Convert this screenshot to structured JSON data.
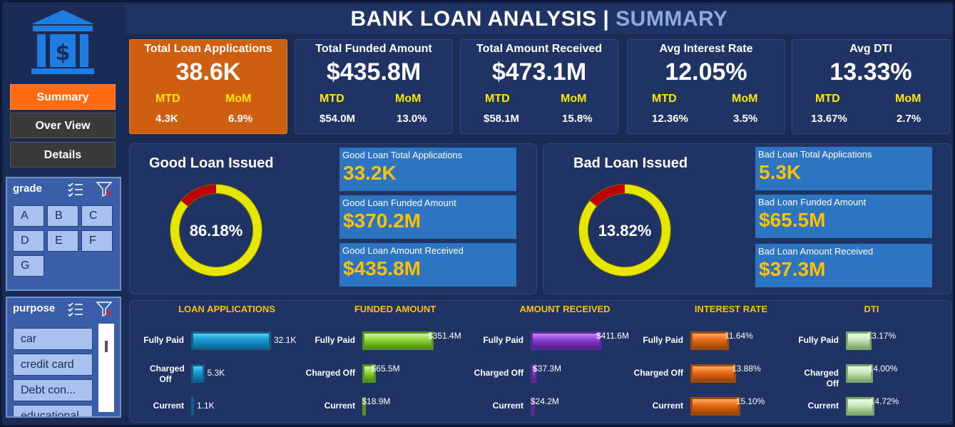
{
  "header": {
    "title_main": "BANK LOAN ANALYSIS",
    "separator": "|",
    "title_sub": "SUMMARY"
  },
  "nav": {
    "summary": "Summary",
    "overview": "Over View",
    "details": "Details"
  },
  "slicers": {
    "grade": {
      "label": "grade",
      "items": [
        "A",
        "B",
        "C",
        "D",
        "E",
        "F",
        "G"
      ]
    },
    "purpose": {
      "label": "purpose",
      "items": [
        "car",
        "credit card",
        "Debt con...",
        "educational"
      ]
    }
  },
  "kpis": [
    {
      "title": "Total Loan Applications",
      "value": "38.6K",
      "mtd_label": "MTD",
      "mom_label": "MoM",
      "mtd": "4.3K",
      "mom": "6.9%"
    },
    {
      "title": "Total Funded Amount",
      "value": "$435.8M",
      "mtd_label": "MTD",
      "mom_label": "MoM",
      "mtd": "$54.0M",
      "mom": "13.0%"
    },
    {
      "title": "Total Amount Received",
      "value": "$473.1M",
      "mtd_label": "MTD",
      "mom_label": "MoM",
      "mtd": "$58.1M",
      "mom": "15.8%"
    },
    {
      "title": "Avg Interest Rate",
      "value": "12.05%",
      "mtd_label": "MTD",
      "mom_label": "MoM",
      "mtd": "12.36%",
      "mom": "3.5%"
    },
    {
      "title": "Avg DTI",
      "value": "13.33%",
      "mtd_label": "MTD",
      "mom_label": "MoM",
      "mtd": "13.67%",
      "mom": "2.7%"
    }
  ],
  "good_loan": {
    "title": "Good Loan Issued",
    "percent_label": "86.18%",
    "percent": 0.8618,
    "tiles": [
      {
        "label": "Good Loan Total Applications",
        "value": "33.2K"
      },
      {
        "label": "Good Loan Funded Amount",
        "value": "$370.2M"
      },
      {
        "label": "Good Loan Amount Received",
        "value": "$435.8M"
      }
    ]
  },
  "bad_loan": {
    "title": "Bad Loan Issued",
    "percent_label": "13.82%",
    "percent": 0.1382,
    "tiles": [
      {
        "label": "Bad Loan Total Applications",
        "value": "5.3K"
      },
      {
        "label": "Bad Loan Funded Amount",
        "value": "$65.5M"
      },
      {
        "label": "Bad Loan Amount Received",
        "value": "$37.3M"
      }
    ]
  },
  "colors": {
    "accent_orange": "#ff6a13",
    "value_gold": "#ffc000",
    "mtd_yellow": "#ffe600"
  },
  "chart_data": [
    {
      "type": "bar",
      "title": "LOAN APPLICATIONS",
      "categories": [
        "Fully Paid",
        "Charged Off",
        "Current"
      ],
      "values": [
        32100,
        5300,
        1100
      ],
      "labels": [
        "32.1K",
        "5.3K",
        "1.1K"
      ]
    },
    {
      "type": "bar",
      "title": "FUNDED AMOUNT",
      "categories": [
        "Fully Paid",
        "Charged Off",
        "Current"
      ],
      "values": [
        351.4,
        65.5,
        18.9
      ],
      "labels": [
        "$351.4M",
        "$65.5M",
        "$18.9M"
      ]
    },
    {
      "type": "bar",
      "title": "AMOUNT RECEIVED",
      "categories": [
        "Fully Paid",
        "Charged Off",
        "Current"
      ],
      "values": [
        411.6,
        37.3,
        24.2
      ],
      "labels": [
        "$411.6M",
        "$37.3M",
        "$24.2M"
      ]
    },
    {
      "type": "bar",
      "title": "INTEREST RATE",
      "categories": [
        "Fully Paid",
        "Charged Off",
        "Current"
      ],
      "values": [
        11.64,
        13.88,
        15.1
      ],
      "labels": [
        "11.64%",
        "13.88%",
        "15.10%"
      ]
    },
    {
      "type": "bar",
      "title": "DTI",
      "categories": [
        "Fully Paid",
        "Charged Off",
        "Current"
      ],
      "values": [
        13.17,
        14.0,
        14.72
      ],
      "labels": [
        "13.17%",
        "14.00%",
        "14.72%"
      ]
    }
  ]
}
